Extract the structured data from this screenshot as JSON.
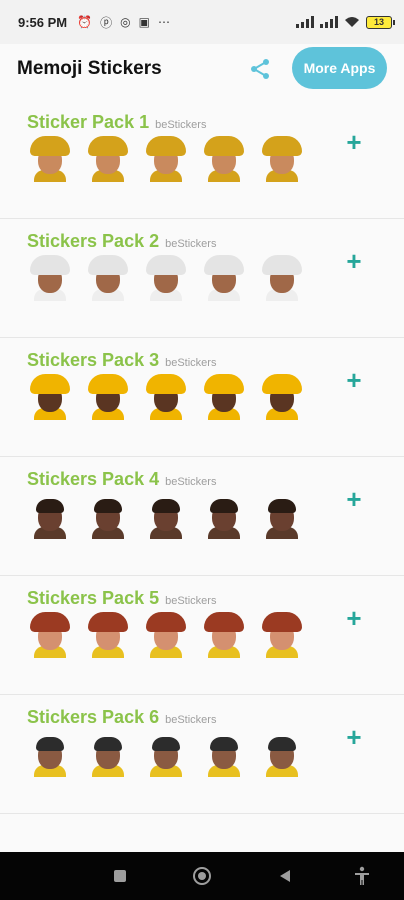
{
  "status_bar": {
    "time": "9:56 PM",
    "left_icons": [
      "alarm-icon",
      "pinterest-icon",
      "instagram-icon",
      "gallery-icon",
      "more-dots-icon"
    ],
    "battery": "13"
  },
  "app_bar": {
    "title": "Memoji Stickers",
    "share_icon": "share-icon",
    "more_apps_label": "More Apps"
  },
  "colors": {
    "accent": "#5ec3da",
    "pack_title": "#8bc34a",
    "add_icon": "#26a69a"
  },
  "packs": [
    {
      "name": "Sticker Pack 1",
      "publisher": "beStickers",
      "add_icon": "plus-icon",
      "skin": "#c98a5e",
      "hat": "#d4a21b",
      "body": "#d4a21b"
    },
    {
      "name": "Stickers Pack 2",
      "publisher": "beStickers",
      "add_icon": "plus-icon",
      "skin": "#a06848",
      "hat": "#e4e4e4",
      "body": "#eeeeee"
    },
    {
      "name": "Stickers Pack 3",
      "publisher": "beStickers",
      "add_icon": "plus-icon",
      "skin": "#5a3522",
      "hat": "#f0b400",
      "body": "#f0b400"
    },
    {
      "name": "Stickers Pack 4",
      "publisher": "beStickers",
      "add_icon": "plus-icon",
      "skin": "#6a4030",
      "hat": "#2a1c14",
      "body": "#5a3a2a"
    },
    {
      "name": "Stickers Pack 5",
      "publisher": "beStickers",
      "add_icon": "plus-icon",
      "skin": "#d49070",
      "hat": "#9b3a22",
      "body": "#e8c020"
    },
    {
      "name": "Stickers Pack 6",
      "publisher": "beStickers",
      "add_icon": "plus-icon",
      "skin": "#8a5a42",
      "hat": "#2c2c2c",
      "body": "#e8c020"
    }
  ],
  "nav_bar": {
    "icons": [
      "recents-square-icon",
      "home-circle-icon",
      "back-triangle-icon",
      "accessibility-icon"
    ]
  }
}
